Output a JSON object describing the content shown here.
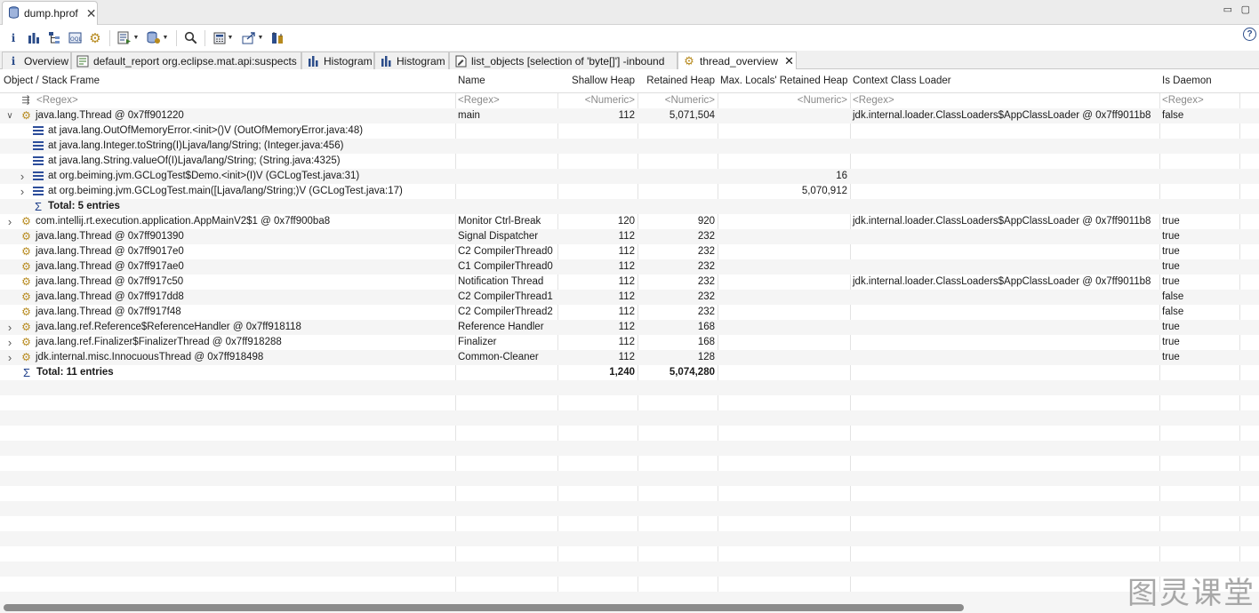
{
  "editor": {
    "tab_title": "dump.hprof",
    "window_controls": [
      "▭",
      "▢"
    ]
  },
  "toolbar": {
    "icons": [
      "info-icon",
      "histogram-icon",
      "dominator-tree-icon",
      "oql-icon",
      "thread-overview-icon",
      "reports-icon",
      "query-browser-icon",
      "search-icon",
      "calculator-icon",
      "export-icon",
      "group-icon"
    ],
    "help_label": "?"
  },
  "result_tabs": [
    {
      "label": "Overview",
      "icon": "info-icon"
    },
    {
      "label": "default_report  org.eclipse.mat.api:suspects",
      "icon": "report-icon"
    },
    {
      "label": "Histogram",
      "icon": "histogram-icon"
    },
    {
      "label": "Histogram",
      "icon": "histogram-icon"
    },
    {
      "label": "list_objects  [selection of 'byte[]'] -inbound",
      "icon": "list-objects-icon"
    },
    {
      "label": "thread_overview",
      "icon": "thread-icon"
    }
  ],
  "table": {
    "columns": [
      "Object / Stack Frame",
      "Name",
      "Shallow Heap",
      "Retained Heap",
      "Max. Locals' Retained Heap",
      "Context Class Loader",
      "Is Daemon"
    ],
    "filters": [
      "<Regex>",
      "<Regex>",
      "<Numeric>",
      "<Numeric>",
      "<Numeric>",
      "<Regex>",
      "<Regex>"
    ],
    "rows": [
      {
        "kind": "thread",
        "twisty": "open",
        "object": "java.lang.Thread @ 0x7ff901220",
        "name": "main",
        "shallow": "112",
        "retained": "5,071,504",
        "maxlocals": "",
        "loader": "jdk.internal.loader.ClassLoaders$AppClassLoader @ 0x7ff9011b8",
        "daemon": "false"
      },
      {
        "kind": "frame",
        "twisty": "",
        "object": "at java.lang.OutOfMemoryError.<init>()V (OutOfMemoryError.java:48)",
        "name": "",
        "shallow": "",
        "retained": "",
        "maxlocals": "",
        "loader": "",
        "daemon": ""
      },
      {
        "kind": "frame",
        "twisty": "",
        "object": "at java.lang.Integer.toString(I)Ljava/lang/String; (Integer.java:456)",
        "name": "",
        "shallow": "",
        "retained": "",
        "maxlocals": "",
        "loader": "",
        "daemon": ""
      },
      {
        "kind": "frame",
        "twisty": "",
        "object": "at java.lang.String.valueOf(I)Ljava/lang/String; (String.java:4325)",
        "name": "",
        "shallow": "",
        "retained": "",
        "maxlocals": "",
        "loader": "",
        "daemon": ""
      },
      {
        "kind": "frame",
        "twisty": "closed",
        "object": "at org.beiming.jvm.GCLogTest$Demo.<init>(I)V (GCLogTest.java:31)",
        "name": "",
        "shallow": "",
        "retained": "",
        "maxlocals": "16",
        "loader": "",
        "daemon": ""
      },
      {
        "kind": "frame",
        "twisty": "closed",
        "object": "at org.beiming.jvm.GCLogTest.main([Ljava/lang/String;)V (GCLogTest.java:17)",
        "name": "",
        "shallow": "",
        "retained": "",
        "maxlocals": "5,070,912",
        "loader": "",
        "daemon": ""
      },
      {
        "kind": "subtotal",
        "twisty": "",
        "object": "Total: 5 entries",
        "name": "",
        "shallow": "",
        "retained": "",
        "maxlocals": "",
        "loader": "",
        "daemon": ""
      },
      {
        "kind": "thread",
        "twisty": "closed",
        "object": "com.intellij.rt.execution.application.AppMainV2$1 @ 0x7ff900ba8",
        "name": "Monitor Ctrl-Break",
        "shallow": "120",
        "retained": "920",
        "maxlocals": "",
        "loader": "jdk.internal.loader.ClassLoaders$AppClassLoader @ 0x7ff9011b8",
        "daemon": "true"
      },
      {
        "kind": "thread",
        "twisty": "",
        "object": "java.lang.Thread @ 0x7ff901390",
        "name": "Signal Dispatcher",
        "shallow": "112",
        "retained": "232",
        "maxlocals": "",
        "loader": "",
        "daemon": "true"
      },
      {
        "kind": "thread",
        "twisty": "",
        "object": "java.lang.Thread @ 0x7ff9017e0",
        "name": "C2 CompilerThread0",
        "shallow": "112",
        "retained": "232",
        "maxlocals": "",
        "loader": "",
        "daemon": "true"
      },
      {
        "kind": "thread",
        "twisty": "",
        "object": "java.lang.Thread @ 0x7ff917ae0",
        "name": "C1 CompilerThread0",
        "shallow": "112",
        "retained": "232",
        "maxlocals": "",
        "loader": "",
        "daemon": "true"
      },
      {
        "kind": "thread",
        "twisty": "",
        "object": "java.lang.Thread @ 0x7ff917c50",
        "name": "Notification Thread",
        "shallow": "112",
        "retained": "232",
        "maxlocals": "",
        "loader": "jdk.internal.loader.ClassLoaders$AppClassLoader @ 0x7ff9011b8",
        "daemon": "true"
      },
      {
        "kind": "thread",
        "twisty": "",
        "object": "java.lang.Thread @ 0x7ff917dd8",
        "name": "C2 CompilerThread1",
        "shallow": "112",
        "retained": "232",
        "maxlocals": "",
        "loader": "",
        "daemon": "false"
      },
      {
        "kind": "thread",
        "twisty": "",
        "object": "java.lang.Thread @ 0x7ff917f48",
        "name": "C2 CompilerThread2",
        "shallow": "112",
        "retained": "232",
        "maxlocals": "",
        "loader": "",
        "daemon": "false"
      },
      {
        "kind": "thread",
        "twisty": "closed",
        "object": "java.lang.ref.Reference$ReferenceHandler @ 0x7ff918118",
        "name": "Reference Handler",
        "shallow": "112",
        "retained": "168",
        "maxlocals": "",
        "loader": "",
        "daemon": "true"
      },
      {
        "kind": "thread",
        "twisty": "closed",
        "object": "java.lang.ref.Finalizer$FinalizerThread @ 0x7ff918288",
        "name": "Finalizer",
        "shallow": "112",
        "retained": "168",
        "maxlocals": "",
        "loader": "",
        "daemon": "true"
      },
      {
        "kind": "thread",
        "twisty": "closed",
        "object": "jdk.internal.misc.InnocuousThread @ 0x7ff918498",
        "name": "Common-Cleaner",
        "shallow": "112",
        "retained": "128",
        "maxlocals": "",
        "loader": "",
        "daemon": "true"
      },
      {
        "kind": "total",
        "twisty": "",
        "object": "Total: 11 entries",
        "name": "",
        "shallow": "1,240",
        "retained": "5,074,280",
        "maxlocals": "",
        "loader": "",
        "daemon": ""
      }
    ]
  },
  "watermark": "图灵课堂"
}
